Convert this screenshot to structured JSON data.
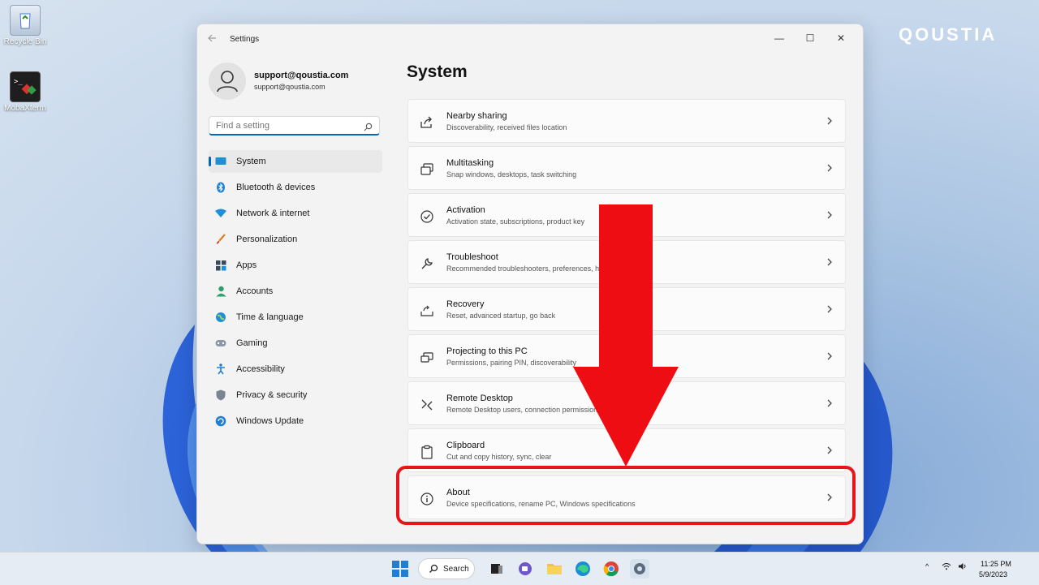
{
  "desktop": {
    "icons": [
      {
        "label": "Recycle Bin"
      },
      {
        "label": "MobaXterm"
      }
    ],
    "brand": "QOUSTIA"
  },
  "window": {
    "title": "Settings",
    "controls": {
      "minimize": "—",
      "maximize": "☐",
      "close": "✕"
    }
  },
  "profile": {
    "name": "support@qoustia.com",
    "email": "support@qoustia.com"
  },
  "search": {
    "placeholder": "Find a setting"
  },
  "nav": {
    "items": [
      {
        "label": "System",
        "icon": "system-icon",
        "active": true
      },
      {
        "label": "Bluetooth & devices",
        "icon": "bluetooth-icon"
      },
      {
        "label": "Network & internet",
        "icon": "wifi-icon"
      },
      {
        "label": "Personalization",
        "icon": "brush-icon"
      },
      {
        "label": "Apps",
        "icon": "apps-icon"
      },
      {
        "label": "Accounts",
        "icon": "person-icon"
      },
      {
        "label": "Time & language",
        "icon": "globe-icon"
      },
      {
        "label": "Gaming",
        "icon": "gamepad-icon"
      },
      {
        "label": "Accessibility",
        "icon": "accessibility-icon"
      },
      {
        "label": "Privacy & security",
        "icon": "shield-icon"
      },
      {
        "label": "Windows Update",
        "icon": "update-icon"
      }
    ]
  },
  "main": {
    "title": "System",
    "cards": [
      {
        "title": "Nearby sharing",
        "subtitle": "Discoverability, received files location",
        "icon": "share-icon"
      },
      {
        "title": "Multitasking",
        "subtitle": "Snap windows, desktops, task switching",
        "icon": "multitask-icon"
      },
      {
        "title": "Activation",
        "subtitle": "Activation state, subscriptions, product key",
        "icon": "check-circle-icon"
      },
      {
        "title": "Troubleshoot",
        "subtitle": "Recommended troubleshooters, preferences, history",
        "icon": "wrench-icon"
      },
      {
        "title": "Recovery",
        "subtitle": "Reset, advanced startup, go back",
        "icon": "recovery-icon"
      },
      {
        "title": "Projecting to this PC",
        "subtitle": "Permissions, pairing PIN, discoverability",
        "icon": "projector-icon"
      },
      {
        "title": "Remote Desktop",
        "subtitle": "Remote Desktop users, connection permissions",
        "icon": "remote-icon"
      },
      {
        "title": "Clipboard",
        "subtitle": "Cut and copy history, sync, clear",
        "icon": "clipboard-icon"
      },
      {
        "title": "About",
        "subtitle": "Device specifications, rename PC, Windows specifications",
        "icon": "info-icon"
      }
    ]
  },
  "annotation": {
    "color": "#e8141c"
  },
  "taskbar": {
    "search_label": "Search",
    "time": "11:25 PM",
    "date": "5/9/2023",
    "tray_chevron": "^"
  },
  "colors": {
    "accent": "#0067c0"
  }
}
